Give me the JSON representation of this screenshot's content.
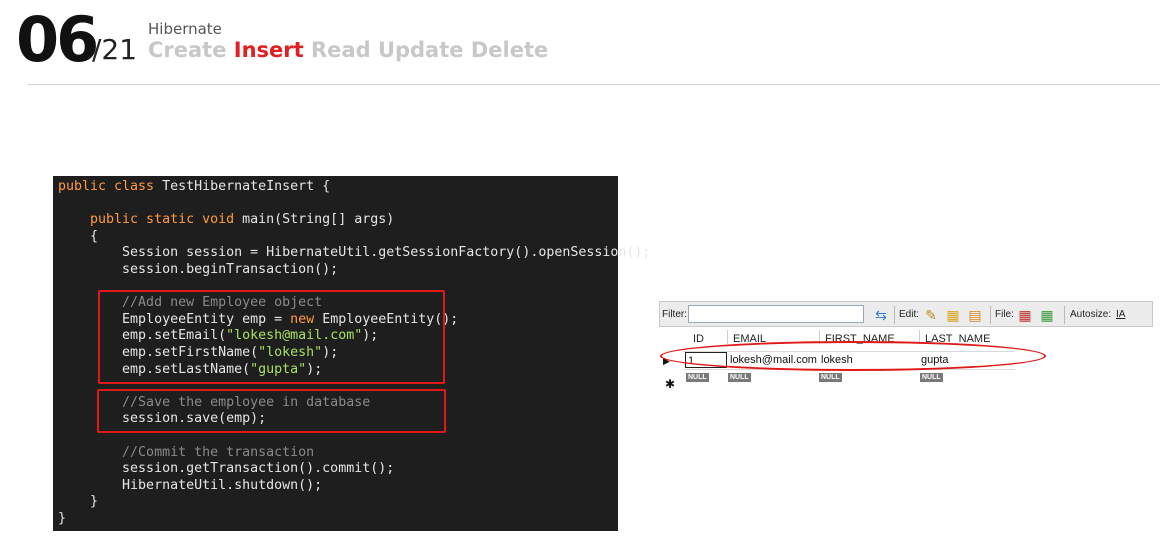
{
  "header": {
    "slide_number": "06",
    "slide_total": "/21",
    "topic": "Hibernate",
    "crud": [
      "Create",
      "Insert",
      "Read",
      "Update",
      "Delete"
    ]
  },
  "code": {
    "lines": [
      {
        "parts": [
          {
            "t": "public class ",
            "c": "kw"
          },
          {
            "t": "TestHibernateInsert {",
            "c": ""
          }
        ]
      },
      {
        "parts": []
      },
      {
        "parts": [
          {
            "t": "    public static void ",
            "c": "kw"
          },
          {
            "t": "main(String[] args)",
            "c": ""
          }
        ]
      },
      {
        "parts": [
          {
            "t": "    {",
            "c": ""
          }
        ]
      },
      {
        "parts": [
          {
            "t": "        Session session = HibernateUtil.getSessionFactory().openSession();",
            "c": ""
          }
        ]
      },
      {
        "parts": [
          {
            "t": "        session.beginTransaction();",
            "c": ""
          }
        ]
      },
      {
        "parts": []
      },
      {
        "parts": [
          {
            "t": "        //Add new Employee object",
            "c": "cm"
          }
        ]
      },
      {
        "parts": [
          {
            "t": "        EmployeeEntity emp = ",
            "c": ""
          },
          {
            "t": "new ",
            "c": "kw"
          },
          {
            "t": "EmployeeEntity();",
            "c": ""
          }
        ]
      },
      {
        "parts": [
          {
            "t": "        emp.setEmail(",
            "c": ""
          },
          {
            "t": "\"lokesh@mail.com\"",
            "c": "str"
          },
          {
            "t": ");",
            "c": ""
          }
        ]
      },
      {
        "parts": [
          {
            "t": "        emp.setFirstName(",
            "c": ""
          },
          {
            "t": "\"lokesh\"",
            "c": "str"
          },
          {
            "t": ");",
            "c": ""
          }
        ]
      },
      {
        "parts": [
          {
            "t": "        emp.setLastName(",
            "c": ""
          },
          {
            "t": "\"gupta\"",
            "c": "str"
          },
          {
            "t": ");",
            "c": ""
          }
        ]
      },
      {
        "parts": []
      },
      {
        "parts": [
          {
            "t": "        //Save the employee in database",
            "c": "cm"
          }
        ]
      },
      {
        "parts": [
          {
            "t": "        session.save(emp);",
            "c": ""
          }
        ]
      },
      {
        "parts": []
      },
      {
        "parts": [
          {
            "t": "        //Commit the transaction",
            "c": "cm"
          }
        ]
      },
      {
        "parts": [
          {
            "t": "        session.getTransaction().commit();",
            "c": ""
          }
        ]
      },
      {
        "parts": [
          {
            "t": "        HibernateUtil.shutdown();",
            "c": ""
          }
        ]
      },
      {
        "parts": [
          {
            "t": "    }",
            "c": ""
          }
        ]
      },
      {
        "parts": [
          {
            "t": "}",
            "c": ""
          }
        ]
      }
    ]
  },
  "grid": {
    "toolbar": {
      "filter_label": "Filter:",
      "edit_label": "Edit:",
      "file_label": "File:",
      "autosize_label": "Autosize:",
      "autosize_icon_text": "IA"
    },
    "columns": [
      "ID",
      "EMAIL",
      "FIRST_NAME",
      "LAST_NAME"
    ],
    "row": [
      "1",
      "lokesh@mail.com",
      "lokesh",
      "gupta"
    ],
    "null_label": "NULL"
  },
  "colors": {
    "accent_red": "#e02020",
    "code_bg": "#1e1e1e",
    "keyword": "#ff9c3f",
    "string": "#a8e060",
    "comment": "#8a8a8a"
  }
}
